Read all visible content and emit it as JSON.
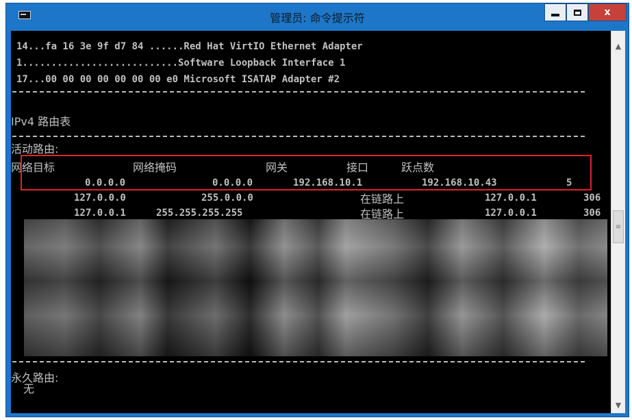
{
  "window": {
    "title": "管理员: 命令提示符",
    "minimize_label": "",
    "maximize_label": "",
    "close_label": "x"
  },
  "console": {
    "lines": [
      "14...fa 16 3e 9f d7 84 ......Red Hat VirtIO Ethernet Adapter",
      "1...........................Software Loopback Interface 1",
      "17...00 00 00 00 00 00 00 e0 Microsoft ISATAP Adapter #2"
    ],
    "ipv4_title": "IPv4 路由表",
    "active_routes_label": "活动路由:",
    "headers": {
      "destination": "网络目标",
      "netmask": "网络掩码",
      "gateway": "网关",
      "interface": "接口",
      "metric": "跃点数"
    },
    "routes": [
      {
        "destination": "0.0.0.0",
        "netmask": "0.0.0.0",
        "gateway": "192.168.10.1",
        "interface": "192.168.10.43",
        "metric": "5"
      },
      {
        "destination": "127.0.0.0",
        "netmask": "255.0.0.0",
        "gateway": "在链路上",
        "interface": "127.0.0.1",
        "metric": "306"
      },
      {
        "destination": "127.0.0.1",
        "netmask": "255.255.255.255",
        "gateway": "在链路上",
        "interface": "127.0.0.1",
        "metric": "306"
      }
    ],
    "persistent_routes_label": "永久路由:",
    "persistent_routes_value": "无"
  },
  "colors": {
    "titlebar": "#1e76c8",
    "console_bg": "#000000",
    "console_text": "#c0c0c0",
    "highlight_border": "#e2212b",
    "close_button": "#c6413a"
  }
}
